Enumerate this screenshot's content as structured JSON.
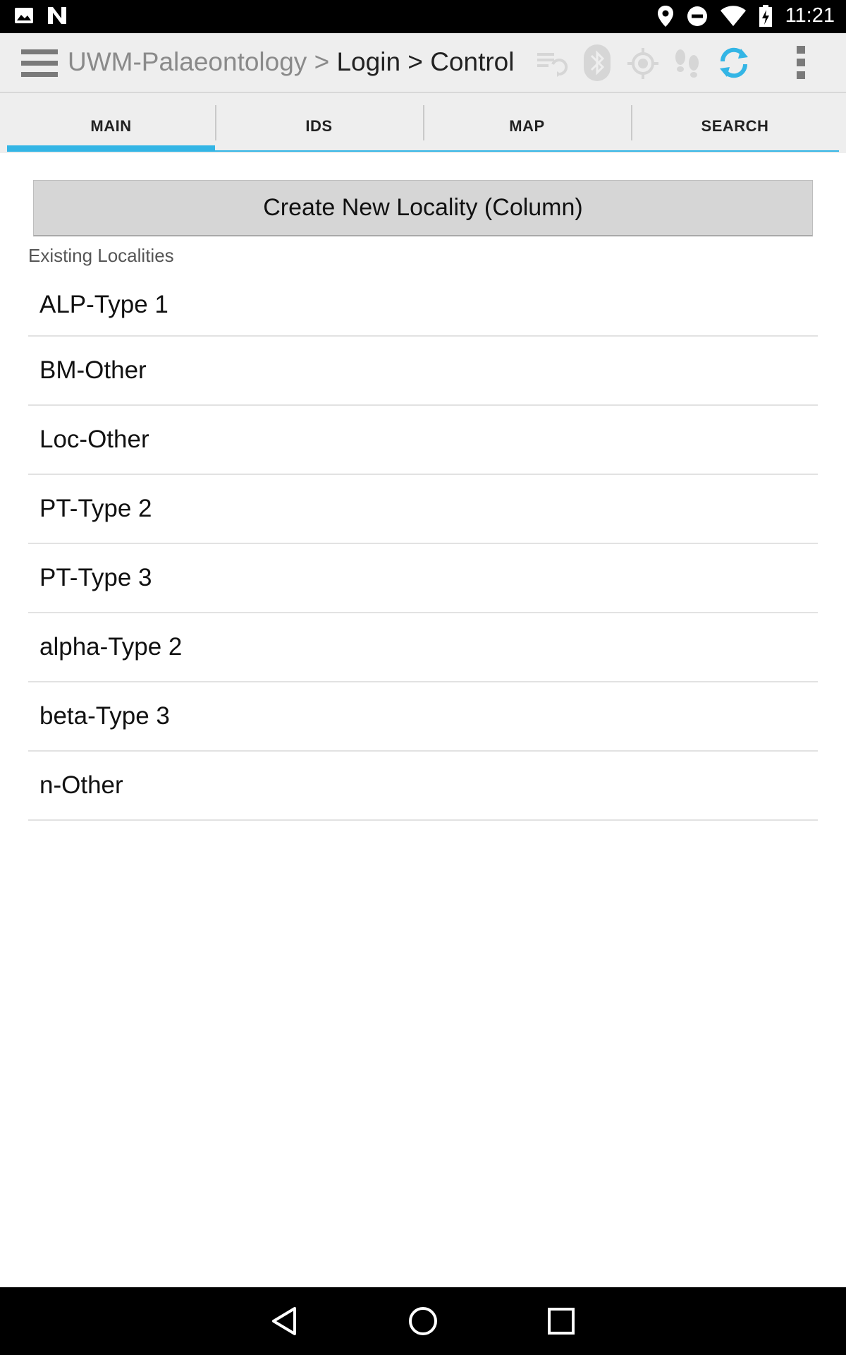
{
  "status_bar": {
    "time": "11:21",
    "icons_left": [
      "image-icon",
      "n-icon"
    ],
    "icons_right": [
      "location-icon",
      "do-not-disturb-icon",
      "wifi-icon",
      "battery-icon"
    ]
  },
  "action_bar": {
    "crumb_app": "UWM-Palaeontology",
    "crumb_sep1": ">",
    "crumb_login": "Login",
    "crumb_sep2": ">",
    "crumb_control": "Control",
    "icons": [
      "sync-queue-icon",
      "bluetooth-icon",
      "gps-icon",
      "tracking-footprints-icon",
      "sync-icon",
      "overflow-menu-icon"
    ],
    "accent_color": "#33b5e5"
  },
  "tabs": [
    {
      "label": "MAIN",
      "active": true
    },
    {
      "label": "IDS",
      "active": false
    },
    {
      "label": "MAP",
      "active": false
    },
    {
      "label": "SEARCH",
      "active": false
    }
  ],
  "main": {
    "create_button_label": "Create New Locality (Column)",
    "section_label": "Existing Localities",
    "localities": [
      "ALP-Type 1",
      "BM-Other",
      "Loc-Other",
      "PT-Type 2",
      "PT-Type 3",
      "alpha-Type 2",
      "beta-Type 3",
      "n-Other"
    ]
  },
  "nav_bar": {
    "icons": [
      "back-icon",
      "home-icon",
      "recents-icon"
    ]
  }
}
